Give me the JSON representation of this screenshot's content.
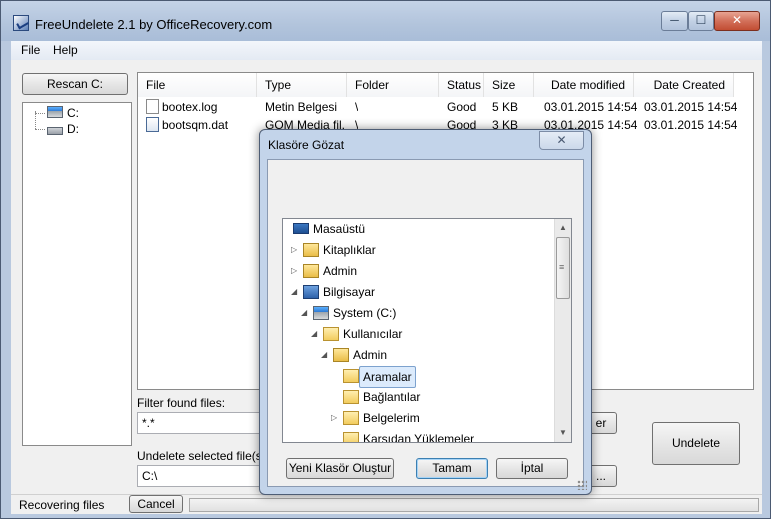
{
  "window": {
    "title": "FreeUndelete 2.1 by OfficeRecovery.com",
    "controls": {
      "minimize": "─",
      "maximize": "☐",
      "close": "✕"
    }
  },
  "menu": {
    "items": [
      "File",
      "Help"
    ]
  },
  "rescan_button": "Rescan C:",
  "drives": [
    {
      "label": "C:",
      "icon": "system-drive-icon"
    },
    {
      "label": "D:",
      "icon": "drive-icon"
    }
  ],
  "filelist": {
    "columns": [
      "File",
      "Type",
      "Folder",
      "Status",
      "Size",
      "Date modified",
      "Date Created"
    ],
    "rows": [
      {
        "file": "bootex.log",
        "type": "Metin Belgesi",
        "folder": "\\",
        "status": "Good",
        "size": "5 KB",
        "modified": "03.01.2015 14:54",
        "created": "03.01.2015 14:54"
      },
      {
        "file": "bootsqm.dat",
        "type": "GOM Media fil...",
        "folder": "\\",
        "status": "Good",
        "size": "3 KB",
        "modified": "03.01.2015 14:54",
        "created": "03.01.2015 14:54"
      }
    ]
  },
  "filter": {
    "label": "Filter found files:",
    "value": "*.*",
    "button_partial": "er"
  },
  "undelete_target": {
    "label": "Undelete selected file(s) to",
    "value": "C:\\",
    "browse_partial": "..."
  },
  "undelete_button": "Undelete",
  "status": {
    "text": "Recovering files",
    "cancel_button": "Cancel"
  },
  "dialog": {
    "title": "Klasöre Gözat",
    "close": "✕",
    "tree": [
      {
        "label": "Masaüstü",
        "icon": "desktop-icon",
        "level": 0,
        "arrow": ""
      },
      {
        "label": "Kitaplıklar",
        "icon": "libraries-icon",
        "level": 1,
        "arrow": "▷"
      },
      {
        "label": "Admin",
        "icon": "user-folder-icon",
        "level": 1,
        "arrow": "▷"
      },
      {
        "label": "Bilgisayar",
        "icon": "computer-icon",
        "level": 1,
        "arrow": "◢"
      },
      {
        "label": "System (C:)",
        "icon": "system-drive-icon",
        "level": 2,
        "arrow": "◢"
      },
      {
        "label": "Kullanıcılar",
        "icon": "folder-icon",
        "level": 3,
        "arrow": "◢"
      },
      {
        "label": "Admin",
        "icon": "user-folder-icon",
        "level": 4,
        "arrow": "◢"
      },
      {
        "label": "Aramalar",
        "icon": "searches-folder-icon",
        "level": 5,
        "arrow": "",
        "selected": true
      },
      {
        "label": "Bağlantılar",
        "icon": "links-folder-icon",
        "level": 5,
        "arrow": ""
      },
      {
        "label": "Belgelerim",
        "icon": "documents-folder-icon",
        "level": 5,
        "arrow": "▷"
      },
      {
        "label": "Karşıdan Yüklemeler",
        "icon": "downloads-folder-icon",
        "level": 5,
        "arrow": ""
      }
    ],
    "buttons": {
      "new_folder": "Yeni Klasör Oluştur",
      "ok": "Tamam",
      "cancel": "İptal"
    },
    "scroll": {
      "up": "▲",
      "down": "▼",
      "grip": "≡"
    }
  }
}
